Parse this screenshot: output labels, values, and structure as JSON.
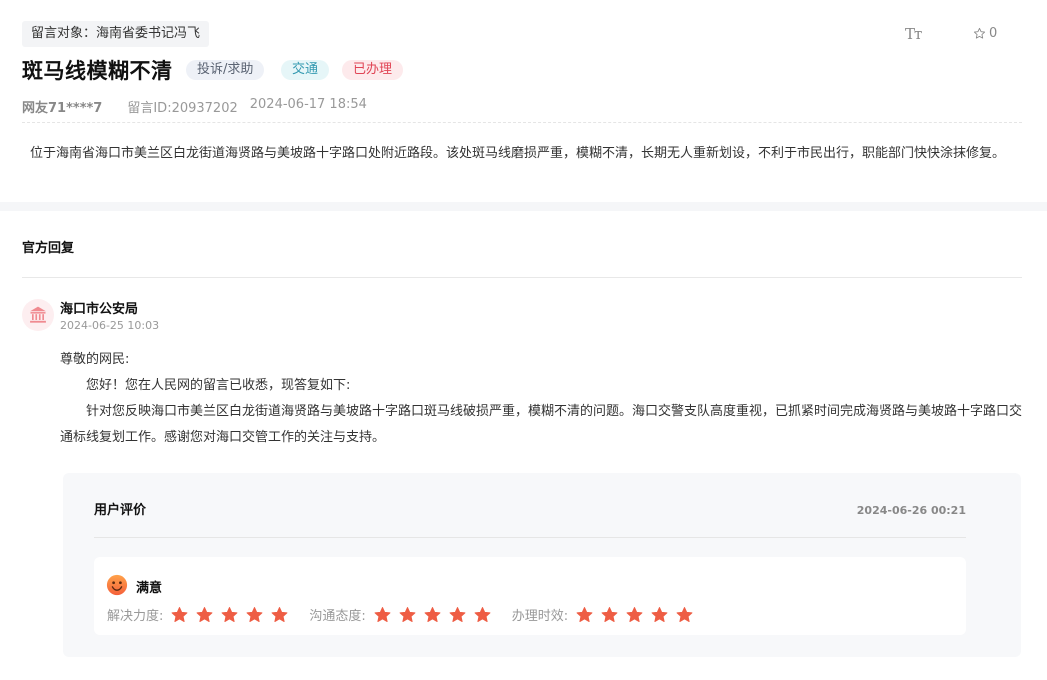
{
  "header": {
    "target_label": "留言对象：海南省委书记冯飞",
    "font_toggle": "Tт",
    "fav_count": "0",
    "title": "斑马线模糊不清",
    "tags": {
      "category": "投诉/求助",
      "field": "交通",
      "status": "已办理"
    },
    "user": "网友71****7",
    "message_id": "留言ID:20937202",
    "posted_at": "2024-06-17 18:54"
  },
  "message": {
    "content": "位于海南省海口市美兰区白龙街道海贤路与美坡路十字路口处附近路段。该处斑马线磨损严重，模糊不清，长期无人重新划设，不利于市民出行，职能部门快快涂抹修复。"
  },
  "reply": {
    "section_title": "官方回复",
    "org_name": "海口市公安局",
    "time": "2024-06-25 10:03",
    "greeting": "尊敬的网民:",
    "line1": "您好！您在人民网的留言已收悉，现答复如下:",
    "line2": "针对您反映海口市美兰区白龙街道海贤路与美坡路十字路口斑马线破损严重，模糊不清的问题。海口交警支队高度重视，已抓紧时间完成海贤路与美坡路十字路口交通标线复划工作。感谢您对海口交管工作的关注与支持。"
  },
  "evaluation": {
    "title": "用户评价",
    "time": "2024-06-26 00:21",
    "result": "满意",
    "ratings": [
      {
        "label": "解决力度:",
        "stars": 5
      },
      {
        "label": "沟通态度:",
        "stars": 5
      },
      {
        "label": "办理时效:",
        "stars": 5
      }
    ]
  },
  "colors": {
    "star": "#ee5d44",
    "status_tag": "#e04455",
    "field_tag": "#3399b0"
  }
}
